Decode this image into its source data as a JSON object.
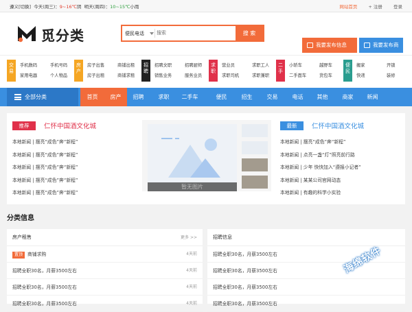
{
  "topbar": {
    "weather_place": "遵义",
    "weather_sep": "[切换]",
    "today_label": "今天(周三)：",
    "today_temp": "9~16℃",
    "today_desc": "阴",
    "tomorrow_label": "明天(周四)：",
    "tomorrow_temp": "10~15℃",
    "tomorrow_desc": "小雨",
    "homepage": "网站首页",
    "register": "+ 注册",
    "login": "登录"
  },
  "header": {
    "logo_text": "觅分类",
    "search_category": "便民电话",
    "search_placeholder": "搜索",
    "search_button": "搜 索",
    "post_info": "我要发布信息",
    "post_merchant": "我要发布商家"
  },
  "categories": [
    {
      "badge": "交易",
      "color": "#f5a623",
      "links": [
        "手机数码",
        "手机号码",
        "家用电器",
        "个人物品"
      ]
    },
    {
      "badge": "房产",
      "color": "#f5a623",
      "links": [
        "房子出售",
        "商铺出租",
        "房子出租",
        "商铺求租"
      ]
    },
    {
      "badge": "招聘",
      "color": "#222222",
      "links": [
        "招聘文职",
        "招聘厨师",
        "销售业务",
        "服务业员"
      ]
    },
    {
      "badge": "求职",
      "color": "#e0314a",
      "links": [
        "营业员",
        "求职工人",
        "求职司机",
        "求职兼职"
      ]
    },
    {
      "badge": "二手",
      "color": "#e0314a",
      "links": [
        "小轿车",
        "越野车",
        "二手面车",
        "货包车"
      ]
    },
    {
      "badge": "便民",
      "color": "#2a9d8f",
      "links": [
        "搬家",
        "开锁",
        "快递",
        "装修"
      ]
    }
  ],
  "nav": {
    "all": "全部分类",
    "items": [
      "首页",
      "房产",
      "招聘",
      "求职",
      "二手车",
      "便民",
      "招生",
      "交易",
      "电话",
      "其他",
      "商家",
      "新闻"
    ]
  },
  "news_left": {
    "tag": "推荐",
    "tag_color": "#e0314a",
    "title": "仁怀中国酒文化城",
    "items": [
      "本地新闻 | 摆亮“成色”奔“新程”",
      "本地新闻 | 摆亮“成色”奔“新程”",
      "本地新闻 | 摆亮“成色”奔“新程”",
      "本地新闻 | 摆亮“成色”奔“新程”",
      "本地新闻 | 摆亮“成色”奔“新程”"
    ]
  },
  "news_right": {
    "tag": "最新",
    "tag_color": "#3a8fe0",
    "title": "仁怀中国酒文化城",
    "items": [
      "本地新闻 | 摆亮“成色”奔“新程”",
      "本地新闻 | 点亮一盏“灯”照亮前行路",
      "本地新闻 | 少年 快快加入“遵报小记者”",
      "本地新闻 | 某某公司官网动态",
      "本地新闻 | 有趣的科学小实验"
    ]
  },
  "center": {
    "caption": "暂无图片"
  },
  "section_title": "分类信息",
  "house": {
    "title": "房产租售",
    "more": "更多 >>",
    "rows": [
      {
        "top": "置顶",
        "text": "商铺求购",
        "time": "4天前"
      },
      {
        "text": "招聘全职30名，月薪3500左右",
        "time": "4天前"
      },
      {
        "text": "招聘全职30名，月薪3500左右",
        "time": "4天前"
      },
      {
        "text": "招聘全职30名，月薪3500左右",
        "time": "4天前"
      }
    ]
  },
  "jobs": {
    "title": "招聘信息",
    "rows": [
      {
        "text": "招聘全职30名，月薪3500左右"
      },
      {
        "text": "招聘全职30名，月薪3500左右"
      },
      {
        "text": "招聘全职30名，月薪3500左右"
      },
      {
        "text": "招聘全职30名，月薪3500左右"
      }
    ]
  },
  "watermark": "海绵软件"
}
